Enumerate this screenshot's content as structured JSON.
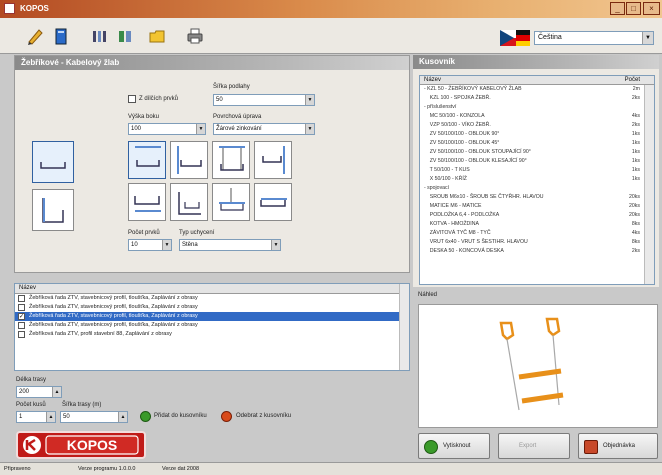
{
  "window": {
    "title": "KOPOS"
  },
  "language": {
    "selected": "Čeština"
  },
  "left_panel": {
    "title": "Žebříkové - Kabelový žlab",
    "checkbox_label": "Z dílčích prvků",
    "width_label": "Šířka podlahy",
    "width_value": "50",
    "wall_label": "Výška boku",
    "wall_value": "100",
    "sortiment_label": "Povrchová úprava",
    "sortiment_value": "Žárové zinkování",
    "anchor_label": "Počet prvků",
    "anchor_value": "10",
    "type_label": "Typ uchycení",
    "type_value": "Stěna"
  },
  "products": {
    "header": "Název",
    "rows": [
      {
        "text": "Žebříková řada ZTV, stavebnicový profil, tloušťka, Zaplávání z obrasy",
        "checked": false,
        "selected": false
      },
      {
        "text": "Žebříková řada ZTV, stavebnicový profil, tloušťka, Zaplávání z obrasy",
        "checked": false,
        "selected": false
      },
      {
        "text": "Žebříková řada ZTV, stavebnicový profil, tloušťka, Zaplávání z obrasy",
        "checked": true,
        "selected": true
      },
      {
        "text": "Žebříková řada ZTV, stavebnicový profil, tloušťka, Zaplávání z obrasy",
        "checked": false,
        "selected": false
      },
      {
        "text": "Žebříková řada ZTV, profil stavební 88, Zaplávání z obrasy",
        "checked": false,
        "selected": false
      }
    ]
  },
  "bottom_controls": {
    "height_label": "Délka trasy",
    "height_value": "200",
    "qty_label": "Počet kusů",
    "rows_label": "Šířka trasy (m)",
    "qty_value": "1",
    "rows_value": "50",
    "add_label": "Přidat do kusovníku",
    "remove_label": "Odebrat z kusovníku"
  },
  "composition": {
    "title": "Kusovník",
    "col_name": "Název",
    "col_qty": "Počet",
    "rows": [
      {
        "name": "- KZL 50 - ŽEBŘÍKOVÝ KABELOVÝ ŽLAB",
        "qty": "2m"
      },
      {
        "name": "    KZL 100 - SPOJKA ŽEBŘ.",
        "qty": "2ks"
      },
      {
        "name": "- příslušenství",
        "qty": ""
      },
      {
        "name": "    MC 50/100 - KONZOLA",
        "qty": "4ks"
      },
      {
        "name": "    VZP 50/100 - VÍKO ŽEBŘ.",
        "qty": "2ks"
      },
      {
        "name": "    ZV 50/100/100 - OBLOUK 90°",
        "qty": "1ks"
      },
      {
        "name": "    ZV 50/100/100 - OBLOUK 45°",
        "qty": "1ks"
      },
      {
        "name": "    ZV 50/100/100 - OBLOUK STOUPAJÍCÍ 90°",
        "qty": "1ks"
      },
      {
        "name": "    ZV 50/100/100 - OBLOUK KLESAJÍCÍ 90°",
        "qty": "1ks"
      },
      {
        "name": "    T 50/100 - T KUS",
        "qty": "1ks"
      },
      {
        "name": "    X 50/100 - KŘÍŽ",
        "qty": "1ks"
      },
      {
        "name": "- spojovací",
        "qty": ""
      },
      {
        "name": "    SROUB M6x10 - ŠROUB SE ČTYŘHR. HLAVOU",
        "qty": "20ks"
      },
      {
        "name": "    MATICE M6 - MATICE",
        "qty": "20ks"
      },
      {
        "name": "    PODLOŽKA 6,4 - PODLOŽKA",
        "qty": "20ks"
      },
      {
        "name": "    KOTVA - HMOŽDINA",
        "qty": "8ks"
      },
      {
        "name": "    ZÁVITOVÁ TYČ M8 - TYČ",
        "qty": "4ks"
      },
      {
        "name": "    VRUT 6x40 - VRUT S ŠESTIHR. HLAVOU",
        "qty": "8ks"
      },
      {
        "name": "    DESKA 50 - KONCOVÁ DESKA",
        "qty": "2ks"
      }
    ]
  },
  "preview": {
    "label": "Náhled"
  },
  "buttons": {
    "print": "Vytisknout",
    "export": "Export",
    "order": "Objednávka"
  },
  "logo": {
    "text": "KOPOS"
  },
  "status": {
    "left": "Připraveno",
    "mid": "Verze programu 1.0.0.0",
    "right": "Verze dat 2008"
  },
  "colors": {
    "accent": "#c01a18",
    "selection": "#316ac5",
    "titlebar": "#c05a2a",
    "add": "#3a9a2a",
    "remove": "#d84a1a"
  }
}
